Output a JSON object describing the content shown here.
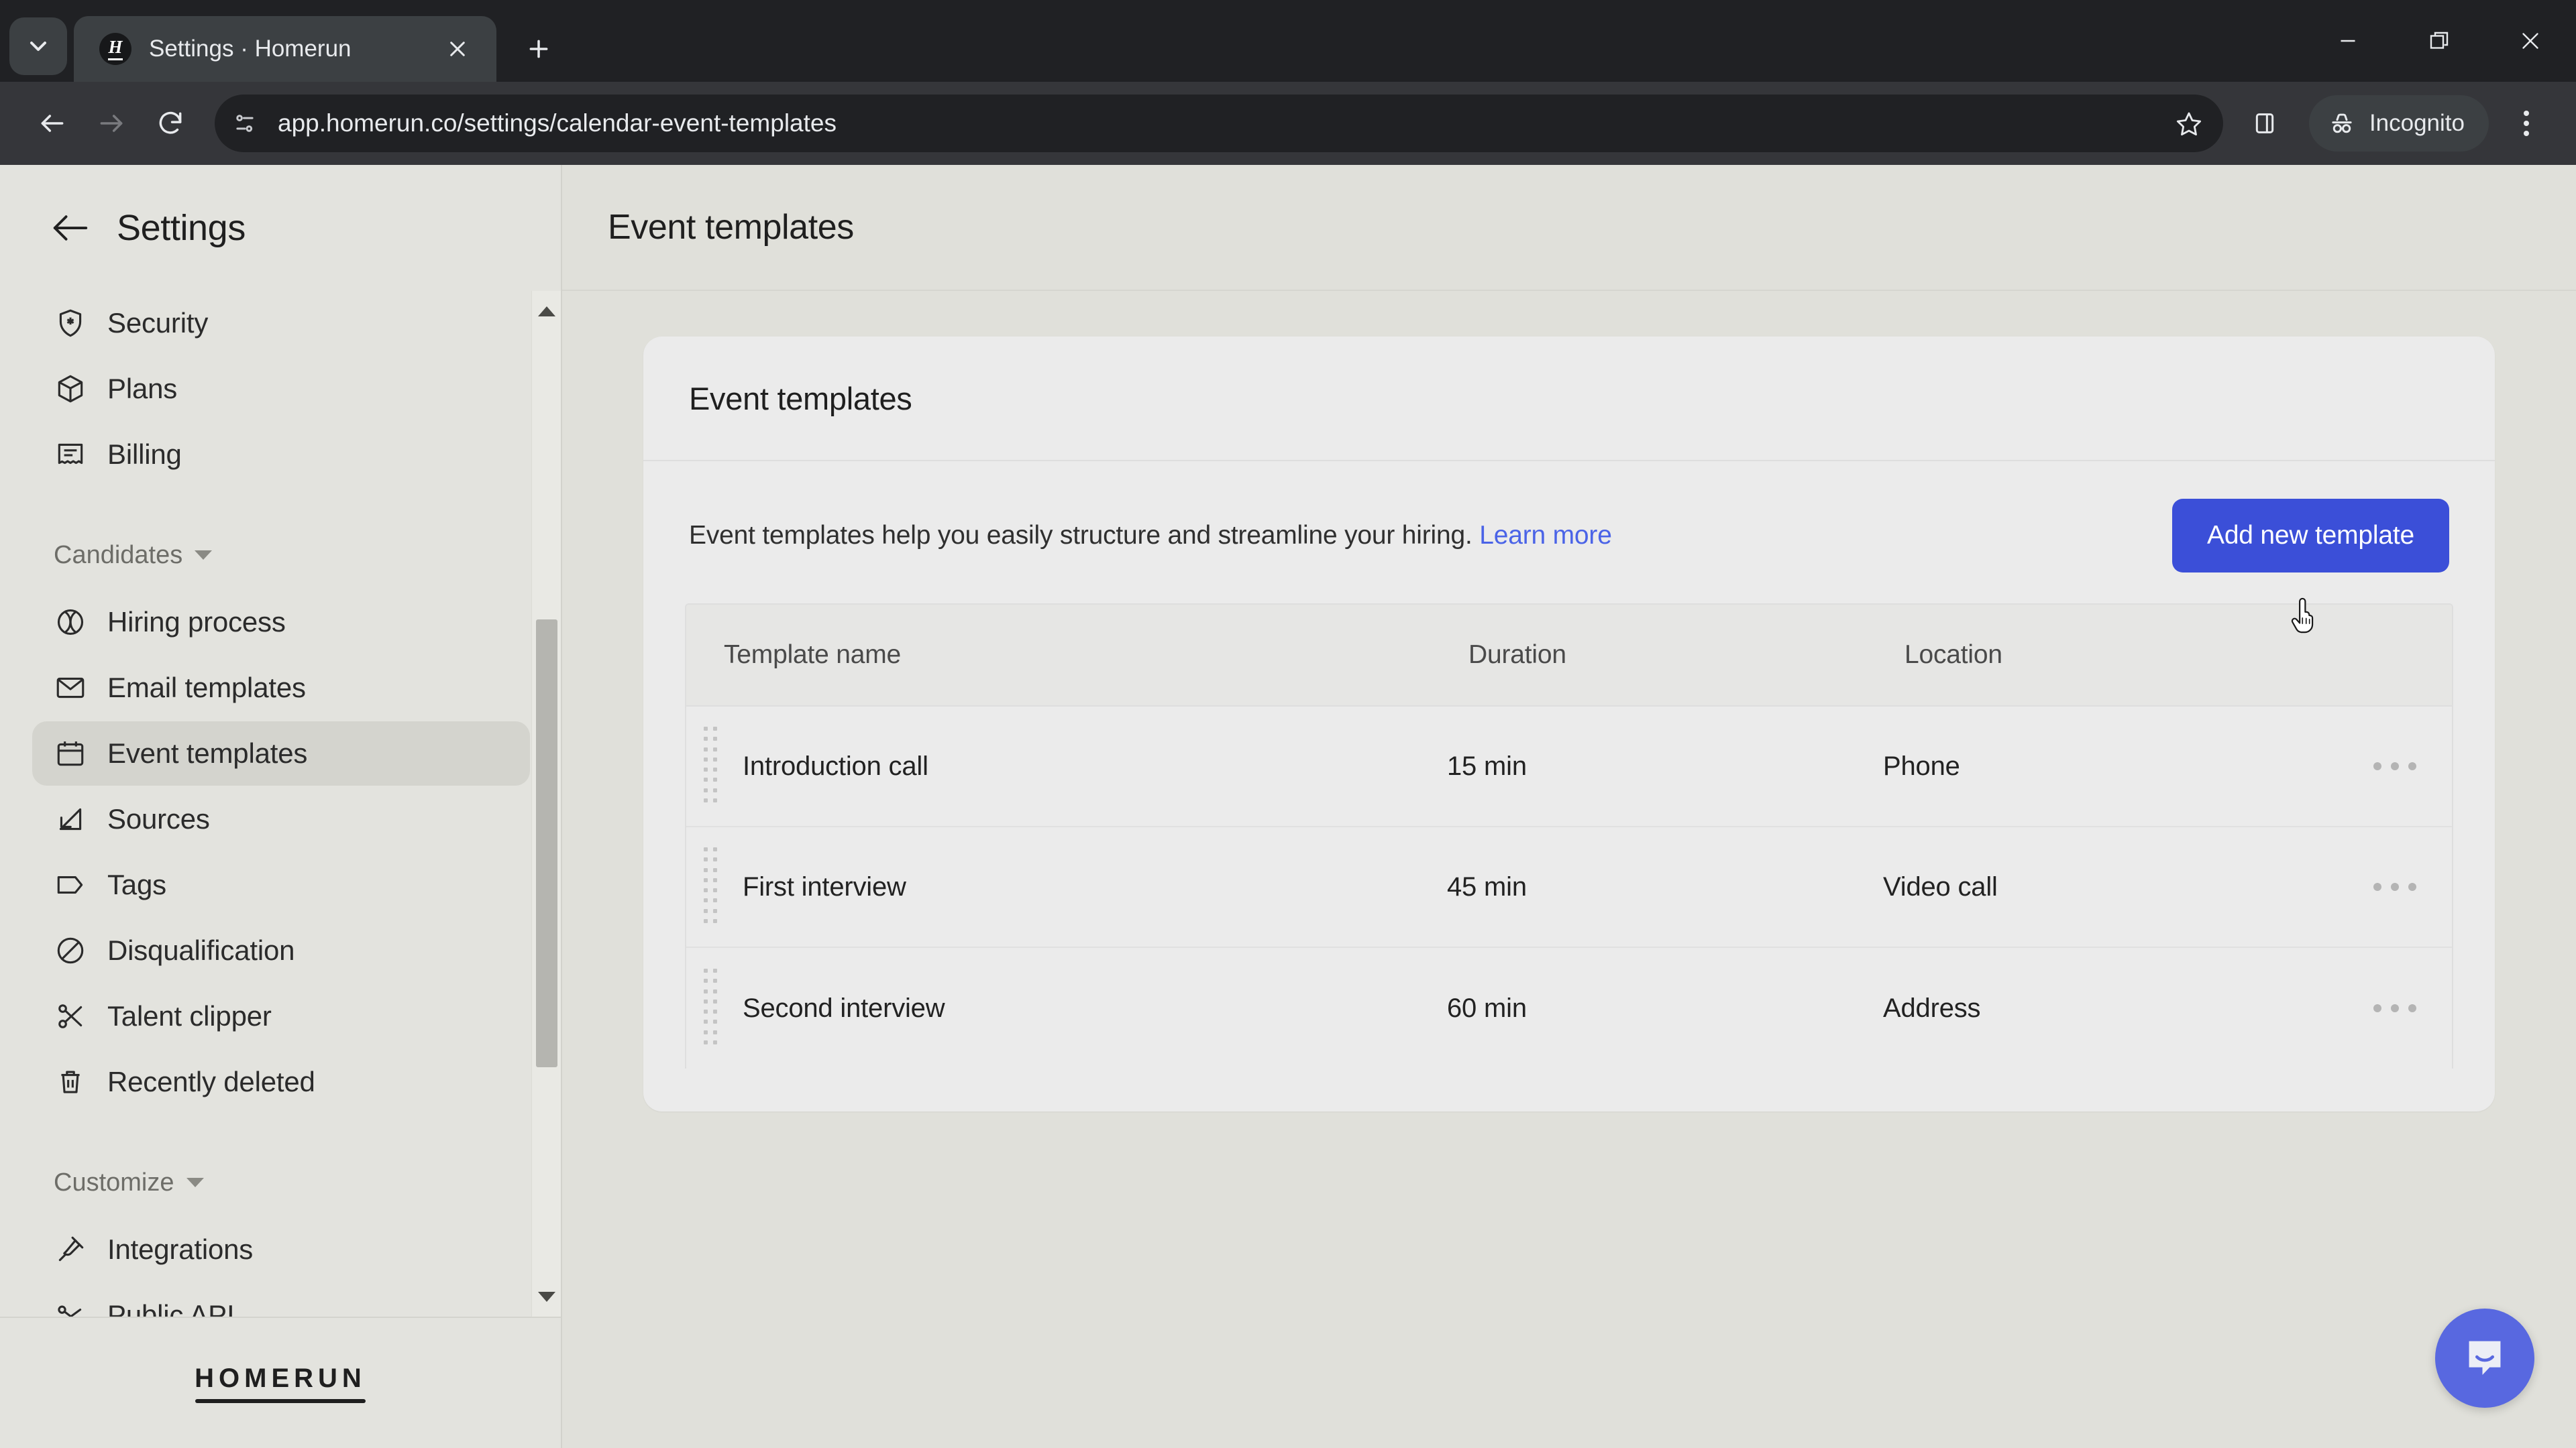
{
  "browser": {
    "tab": {
      "title": "Settings · Homerun",
      "favicon_letter": "H",
      "favicon_name": "homerun-favicon",
      "close_icon": "close-icon"
    },
    "tab_list_icon": "chevron-down-icon",
    "new_tab_icon": "plus-icon",
    "window_controls": {
      "minimize": "minimize-icon",
      "maximize": "restore-icon",
      "close": "close-icon"
    },
    "nav": {
      "back_icon": "arrow-left-icon",
      "forward_icon": "arrow-right-icon",
      "reload_icon": "reload-icon"
    },
    "omnibox": {
      "site_info_icon": "page-info-icon",
      "url": "app.homerun.co/settings/calendar-event-templates",
      "bookmark_icon": "star-icon"
    },
    "side_panel_icon": "side-panel-icon",
    "incognito": {
      "label": "Incognito",
      "icon": "incognito-icon"
    },
    "menu_icon": "three-dot-menu-icon"
  },
  "sidebar": {
    "title": "Settings",
    "back_icon": "arrow-left-icon",
    "items_top": [
      {
        "label": "Security",
        "icon": "shield-star-icon",
        "active": false
      },
      {
        "label": "Plans",
        "icon": "box-icon",
        "active": false
      },
      {
        "label": "Billing",
        "icon": "receipt-icon",
        "active": false
      }
    ],
    "groups": [
      {
        "label": "Candidates",
        "caret_icon": "chevron-down-icon",
        "items": [
          {
            "label": "Hiring process",
            "icon": "circle-process-icon",
            "active": false
          },
          {
            "label": "Email templates",
            "icon": "envelope-icon",
            "active": false
          },
          {
            "label": "Event templates",
            "icon": "calendar-icon",
            "active": true
          },
          {
            "label": "Sources",
            "icon": "arrow-out-square-icon",
            "active": false
          },
          {
            "label": "Tags",
            "icon": "tag-icon",
            "active": false
          },
          {
            "label": "Disqualification",
            "icon": "no-entry-icon",
            "active": false
          },
          {
            "label": "Talent clipper",
            "icon": "scissors-icon",
            "active": false
          },
          {
            "label": "Recently deleted",
            "icon": "trash-icon",
            "active": false
          }
        ]
      },
      {
        "label": "Customize",
        "caret_icon": "chevron-down-icon",
        "items": [
          {
            "label": "Integrations",
            "icon": "plug-icon",
            "active": false
          },
          {
            "label": "Public API",
            "icon": "api-key-icon",
            "active": false
          }
        ]
      }
    ],
    "scrollbar": {
      "up_arrow_icon": "scroll-up-arrow-icon",
      "down_arrow_icon": "scroll-down-arrow-icon"
    },
    "logo": "HOMERUN"
  },
  "main": {
    "header_title": "Event templates",
    "card": {
      "title": "Event templates",
      "intro_text": "Event templates help you easily structure and streamline your hiring. ",
      "intro_link": "Learn more",
      "add_button": "Add new template",
      "accent_color": "#3b4fd8",
      "table": {
        "columns": [
          "Template name",
          "Duration",
          "Location"
        ],
        "rows": [
          {
            "name": "Introduction call",
            "duration": "15 min",
            "location": "Phone",
            "drag_icon": "drag-handle-icon",
            "actions_icon": "three-dot-menu-icon"
          },
          {
            "name": "First interview",
            "duration": "45 min",
            "location": "Video call",
            "drag_icon": "drag-handle-icon",
            "actions_icon": "three-dot-menu-icon"
          },
          {
            "name": "Second interview",
            "duration": "60 min",
            "location": "Address",
            "drag_icon": "drag-handle-icon",
            "actions_icon": "three-dot-menu-icon"
          }
        ]
      }
    },
    "chat_launcher_icon": "intercom-chat-icon",
    "chat_launcher_color": "#5868e0",
    "cursor_icon": "pointing-hand-cursor"
  }
}
